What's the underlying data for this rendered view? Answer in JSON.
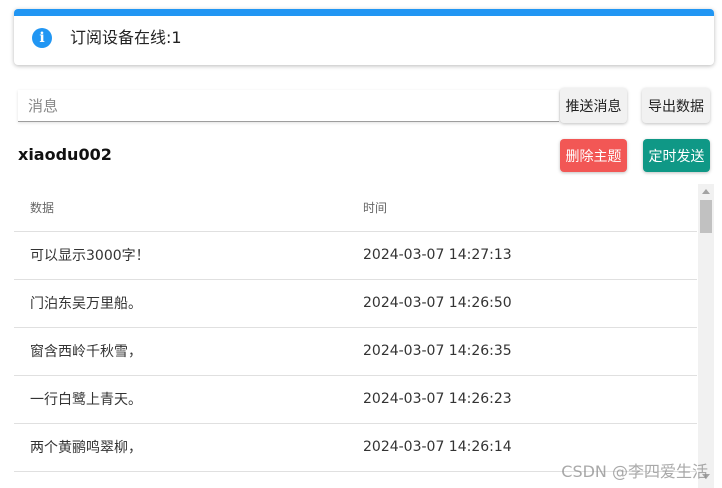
{
  "alert": {
    "icon": "info-icon",
    "icon_glyph": "i",
    "text": "订阅设备在线:1",
    "accent_color": "#2196f3"
  },
  "message": {
    "placeholder": "消息",
    "value": ""
  },
  "buttons": {
    "send": "推送消息",
    "export": "导出数据",
    "delete_topic": "删除主题",
    "timed_send": "定时发送"
  },
  "colors": {
    "delete_button": "#f25755",
    "timed_send_button": "#0f9886"
  },
  "topic": {
    "name": "xiaodu002"
  },
  "table": {
    "headers": [
      "数据",
      "时间"
    ],
    "rows": [
      {
        "data": "可以显示3000字！",
        "time": "2024-03-07 14:27:13"
      },
      {
        "data": "门泊东吴万里船。",
        "time": "2024-03-07 14:26:50"
      },
      {
        "data": "窗含西岭千秋雪，",
        "time": "2024-03-07 14:26:35"
      },
      {
        "data": "一行白鹭上青天。",
        "time": "2024-03-07 14:26:23"
      },
      {
        "data": "两个黄鹂鸣翠柳，",
        "time": "2024-03-07 14:26:14"
      }
    ]
  },
  "watermark": "CSDN @李四爱生活"
}
